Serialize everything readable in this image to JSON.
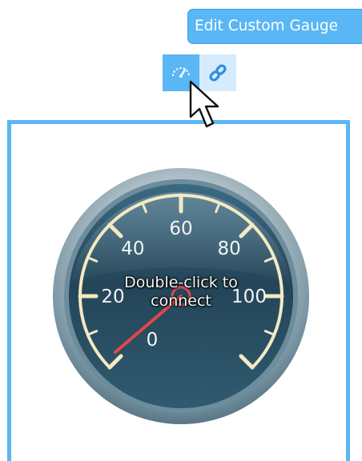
{
  "toolbar": {
    "edit_button_label": "Edit Custom Gauge",
    "gauge_tool_icon": "gauge-needle-icon",
    "link_tool_icon": "link-icon"
  },
  "gauge": {
    "tick_labels": [
      "20",
      "40",
      "60",
      "80",
      "100"
    ],
    "center_label": "0",
    "scale_min": 0,
    "scale_max": 120,
    "needle_value": 2,
    "overlay_line_1": "Double-click to",
    "overlay_line_2": "connect"
  },
  "colors": {
    "accent": "#5ab6f4",
    "gauge_face": "#2f5870",
    "scale_cream": "#f4e9c2",
    "needle": "#e04848"
  }
}
